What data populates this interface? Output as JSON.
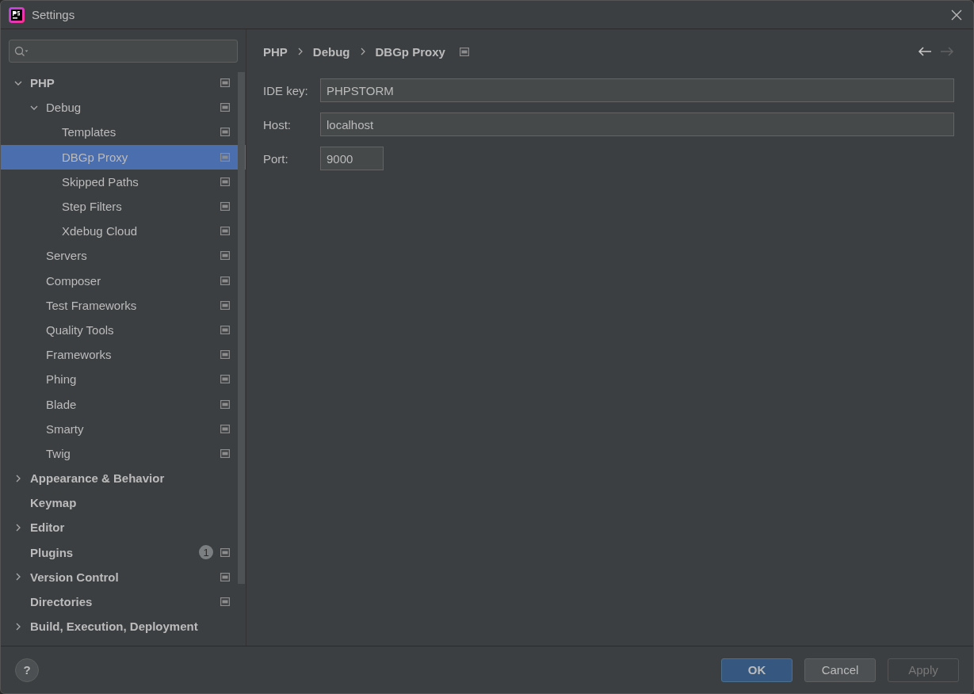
{
  "window": {
    "title": "Settings"
  },
  "tree": [
    {
      "label": "PHP",
      "expanded": true,
      "project_icon": true,
      "selected": false,
      "children": [
        {
          "label": "Debug",
          "expanded": true,
          "project_icon": true,
          "selected": false,
          "children": [
            {
              "label": "Templates",
              "project_icon": true,
              "selected": false
            },
            {
              "label": "DBGp Proxy",
              "project_icon": true,
              "selected": true
            },
            {
              "label": "Skipped Paths",
              "project_icon": true,
              "selected": false
            },
            {
              "label": "Step Filters",
              "project_icon": true,
              "selected": false
            },
            {
              "label": "Xdebug Cloud",
              "project_icon": true,
              "selected": false
            }
          ]
        },
        {
          "label": "Servers",
          "project_icon": true,
          "selected": false
        },
        {
          "label": "Composer",
          "project_icon": true,
          "selected": false
        },
        {
          "label": "Test Frameworks",
          "project_icon": true,
          "selected": false
        },
        {
          "label": "Quality Tools",
          "project_icon": true,
          "selected": false
        },
        {
          "label": "Frameworks",
          "project_icon": true,
          "selected": false
        },
        {
          "label": "Phing",
          "project_icon": true,
          "selected": false
        },
        {
          "label": "Blade",
          "project_icon": true,
          "selected": false
        },
        {
          "label": "Smarty",
          "project_icon": true,
          "selected": false
        },
        {
          "label": "Twig",
          "project_icon": true,
          "selected": false
        }
      ]
    },
    {
      "label": "Appearance & Behavior",
      "expanded": false,
      "project_icon": false,
      "selected": false
    },
    {
      "label": "Keymap",
      "project_icon": false,
      "selected": false
    },
    {
      "label": "Editor",
      "expanded": false,
      "project_icon": false,
      "selected": false
    },
    {
      "label": "Plugins",
      "badge": "1",
      "project_icon": true,
      "selected": false
    },
    {
      "label": "Version Control",
      "expanded": false,
      "project_icon": true,
      "selected": false
    },
    {
      "label": "Directories",
      "project_icon": true,
      "selected": false
    },
    {
      "label": "Build, Execution, Deployment",
      "expanded": false,
      "project_icon": false,
      "selected": false
    }
  ],
  "breadcrumb": [
    {
      "label": "PHP"
    },
    {
      "label": "Debug"
    },
    {
      "label": "DBGp Proxy"
    }
  ],
  "form": [
    {
      "label": "IDE key:",
      "value": "PHPSTORM",
      "kind": "wide"
    },
    {
      "label": "Host:",
      "value": "localhost",
      "kind": "wide"
    },
    {
      "label": "Port:",
      "value": "9000",
      "kind": "narrow"
    }
  ],
  "help": {
    "label": "?"
  },
  "buttons": [
    {
      "label": "OK",
      "kind": "default",
      "disabled": false
    },
    {
      "label": "Cancel",
      "kind": "normal",
      "disabled": false
    },
    {
      "label": "Apply",
      "kind": "normal",
      "disabled": true
    }
  ]
}
